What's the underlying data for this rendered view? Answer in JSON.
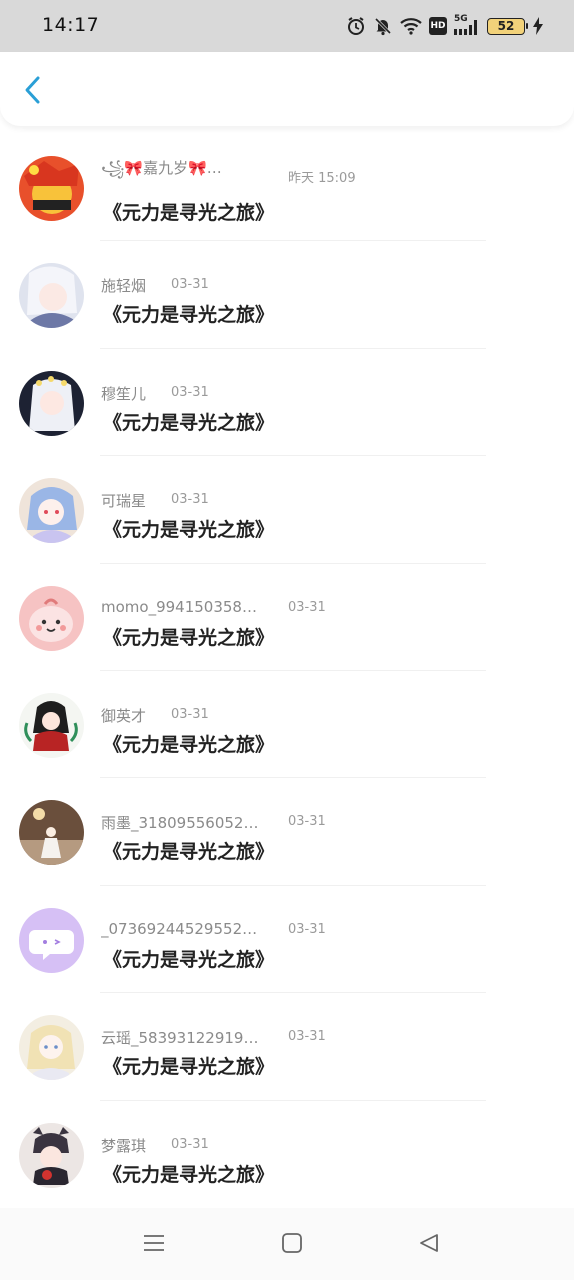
{
  "status_bar": {
    "time": "14:17",
    "network": "5G",
    "hd": "HD",
    "battery": "52"
  },
  "header": {
    "back_icon": "chevron-left-icon",
    "accent_color": "#2a9fd6"
  },
  "messages": [
    {
      "name": "꧁🎀嘉九岁🎀…",
      "time": "昨天  15:09",
      "text": "《元力是寻光之旅》",
      "avatar_bg": "#e8502b"
    },
    {
      "name": "施轻烟",
      "time": "03-31",
      "text": "《元力是寻光之旅》",
      "avatar_bg": "#dfe3ee"
    },
    {
      "name": "穆笙儿",
      "time": "03-31",
      "text": "《元力是寻光之旅》",
      "avatar_bg": "#1d2233"
    },
    {
      "name": "可瑞星",
      "time": "03-31",
      "text": "《元力是寻光之旅》",
      "avatar_bg": "#efe4da"
    },
    {
      "name": "momo_994150358…",
      "time": "03-31",
      "text": "《元力是寻光之旅》",
      "avatar_bg": "#f6c3c3"
    },
    {
      "name": "御英才",
      "time": "03-31",
      "text": "《元力是寻光之旅》",
      "avatar_bg": "#f4f6f2"
    },
    {
      "name": "雨墨_31809556052…",
      "time": "03-31",
      "text": "《元力是寻光之旅》",
      "avatar_bg": "#6a4f3c"
    },
    {
      "name": "_07369244529552…",
      "time": "03-31",
      "text": "《元力是寻光之旅》",
      "avatar_bg": "#d6c0f5"
    },
    {
      "name": "云瑶_58393122919…",
      "time": "03-31",
      "text": "《元力是寻光之旅》",
      "avatar_bg": "#f3eee2"
    },
    {
      "name": "梦露琪",
      "time": "03-31",
      "text": "《元力是寻光之旅》",
      "avatar_bg": "#ece6e4"
    }
  ],
  "nav": {
    "menu_icon": "menu-icon",
    "home_icon": "home-square-icon",
    "back_icon": "back-triangle-icon"
  }
}
